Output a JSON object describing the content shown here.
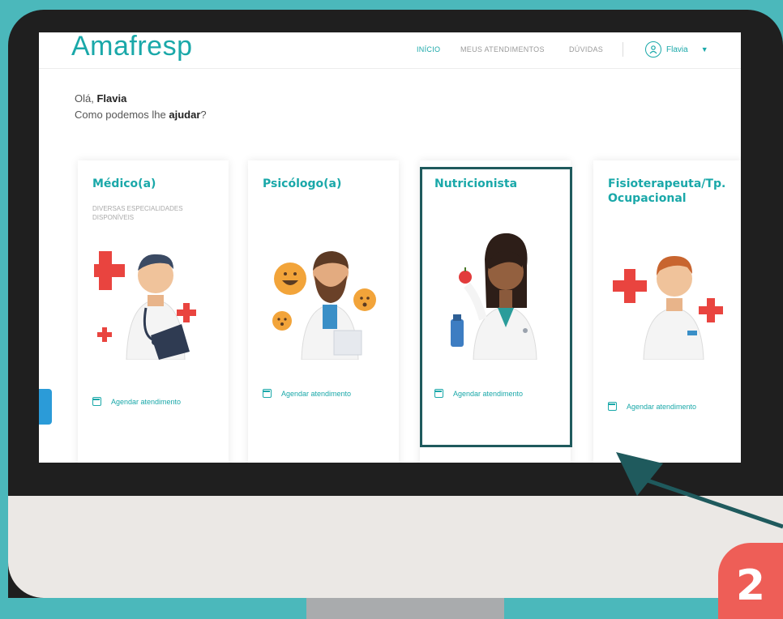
{
  "header": {
    "logo": "Amafresp",
    "nav": [
      "INÍCIO",
      "MEUS ATENDIMENTOS",
      "DÚVIDAS"
    ],
    "user_name": "Flavia"
  },
  "greeting": {
    "hello": "Olá,",
    "name": "Flavia",
    "question_prefix": "Como podemos lhe",
    "question_bold": "ajudar",
    "question_suffix": "?"
  },
  "cards": [
    {
      "title": "Médico(a)",
      "subtitle": "DIVERSAS ESPECIALIDADES DISPONÍVEIS",
      "action": "Agendar atendimento"
    },
    {
      "title": "Psicólogo(a)",
      "subtitle": "",
      "action": "Agendar atendimento"
    },
    {
      "title": "Nutricionista",
      "subtitle": "",
      "action": "Agendar atendimento"
    },
    {
      "title": "Fisioterapeuta/Tp. Ocupacional",
      "subtitle": "",
      "action": "Agendar atendimento"
    }
  ],
  "step_badge": "2",
  "colors": {
    "brand": "#1aa8a9",
    "background": "#4bb8bb",
    "badge": "#ee5e57",
    "highlight": "#1f5a5d"
  }
}
